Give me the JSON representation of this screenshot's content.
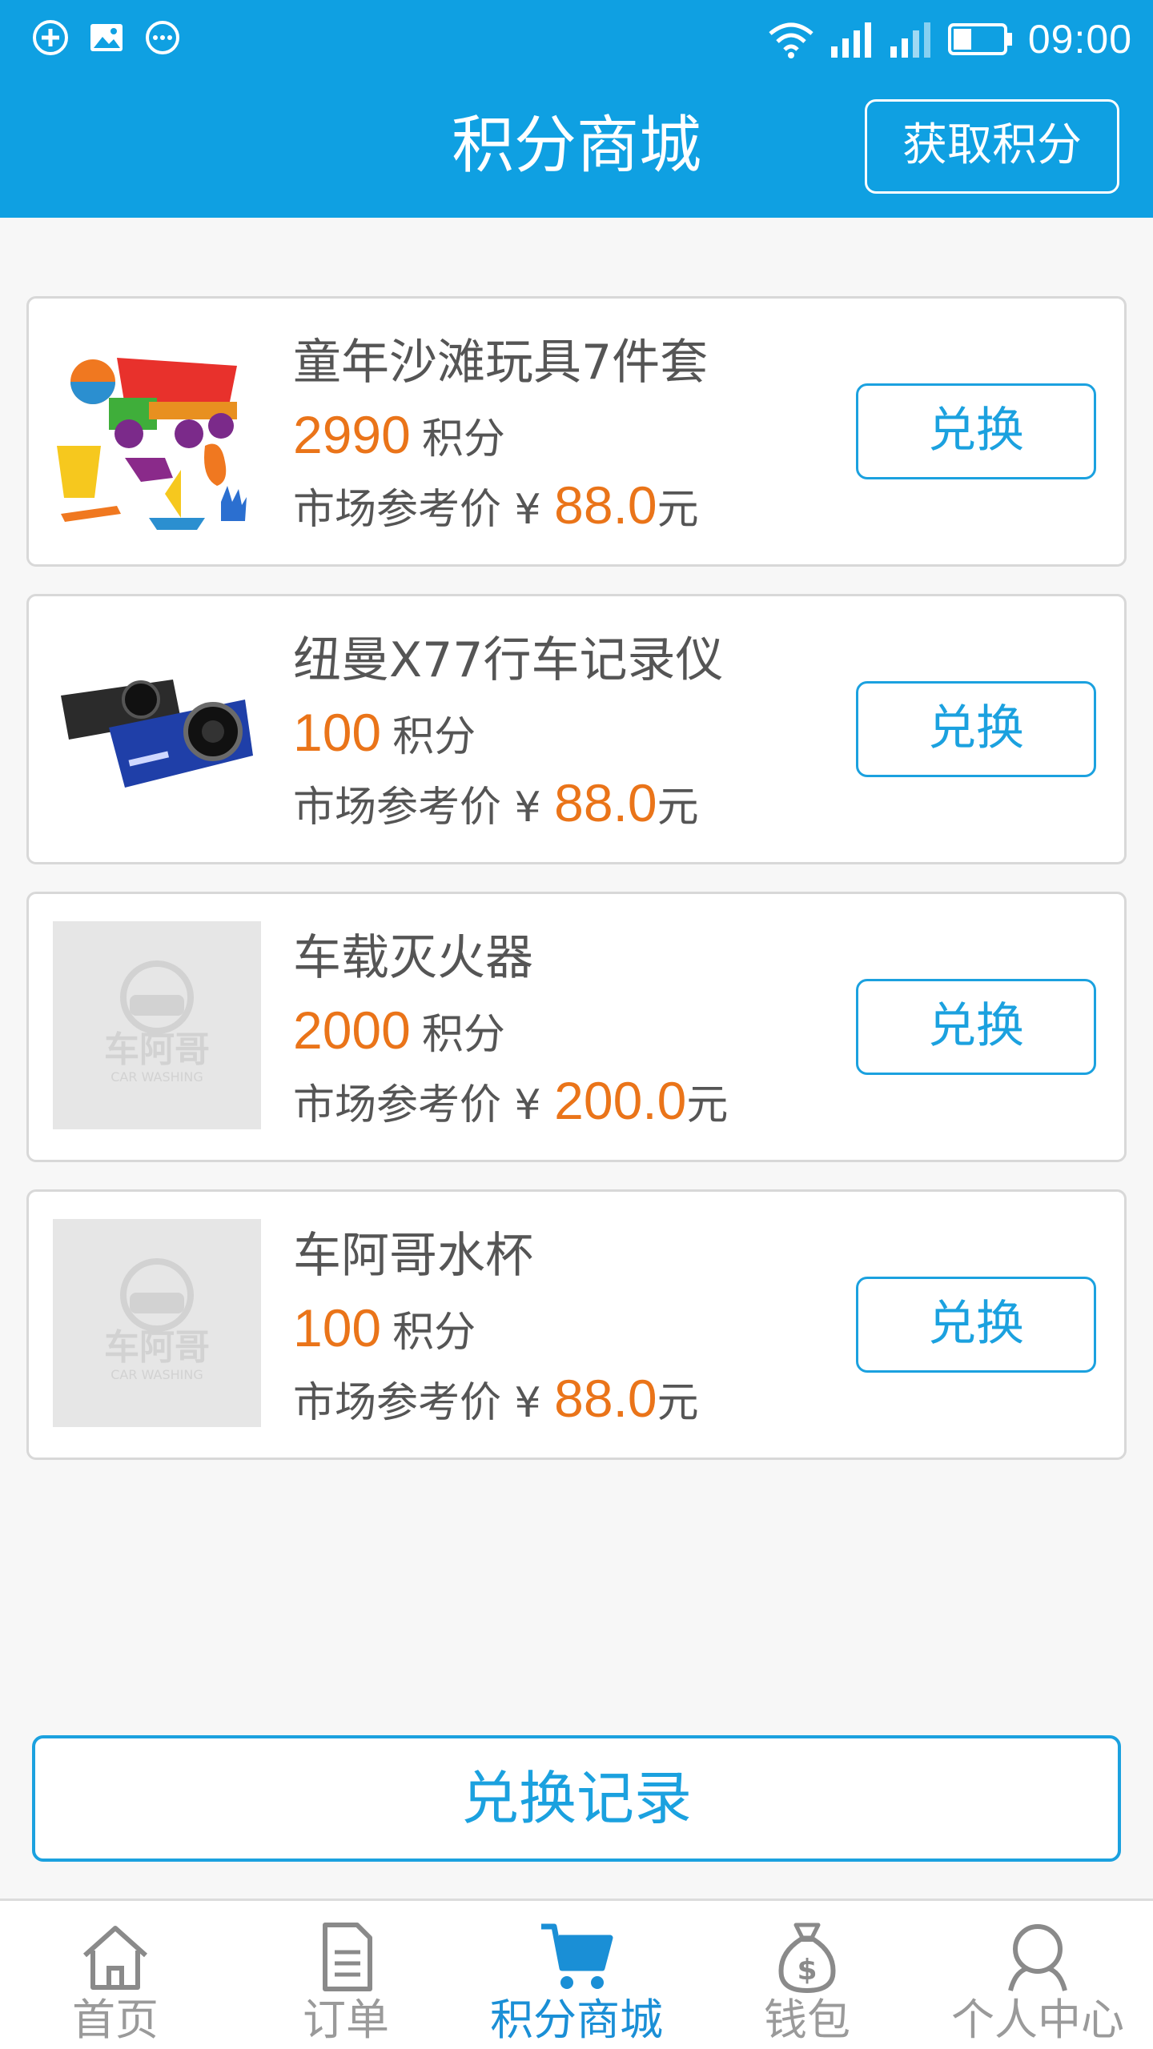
{
  "status_bar": {
    "time": "09:00",
    "left_icons": [
      "sync-icon",
      "image-icon",
      "more-icon"
    ],
    "right_icons": [
      "wifi-icon",
      "signal-icon",
      "signal-icon",
      "battery-icon"
    ]
  },
  "header": {
    "title": "积分商城",
    "get_points_label": "获取积分"
  },
  "products": [
    {
      "name": "童年沙滩玩具7件套",
      "points": "2990",
      "points_unit": "积分",
      "price_label": "市场参考价 ¥ ",
      "price": "88.0",
      "price_unit": "元",
      "button": "兑换",
      "image": "beach-toys"
    },
    {
      "name": "纽曼X77行车记录仪",
      "points": "100",
      "points_unit": "积分",
      "price_label": "市场参考价 ¥ ",
      "price": "88.0",
      "price_unit": "元",
      "button": "兑换",
      "image": "dash-cam"
    },
    {
      "name": "车载灭火器",
      "points": "2000",
      "points_unit": "积分",
      "price_label": "市场参考价 ¥ ",
      "price": "200.0",
      "price_unit": "元",
      "button": "兑换",
      "image": "placeholder"
    },
    {
      "name": "车阿哥水杯",
      "points": "100",
      "points_unit": "积分",
      "price_label": "市场参考价 ¥ ",
      "price": "88.0",
      "price_unit": "元",
      "button": "兑换",
      "image": "placeholder"
    }
  ],
  "placeholder_logo": {
    "text": "车阿哥",
    "subtext": "CAR WASHING"
  },
  "records_button": "兑换记录",
  "nav": {
    "items": [
      {
        "label": "首页",
        "icon": "home-icon",
        "active": false
      },
      {
        "label": "订单",
        "icon": "document-icon",
        "active": false
      },
      {
        "label": "积分商城",
        "icon": "cart-icon",
        "active": true
      },
      {
        "label": "钱包",
        "icon": "money-bag-icon",
        "active": false
      },
      {
        "label": "个人中心",
        "icon": "person-icon",
        "active": false
      }
    ]
  },
  "colors": {
    "header": "#0fa0e2",
    "accent": "#1ba1df",
    "price": "#ea7419",
    "nav_inactive": "#9a9a9a",
    "nav_active": "#1a8fd6"
  }
}
